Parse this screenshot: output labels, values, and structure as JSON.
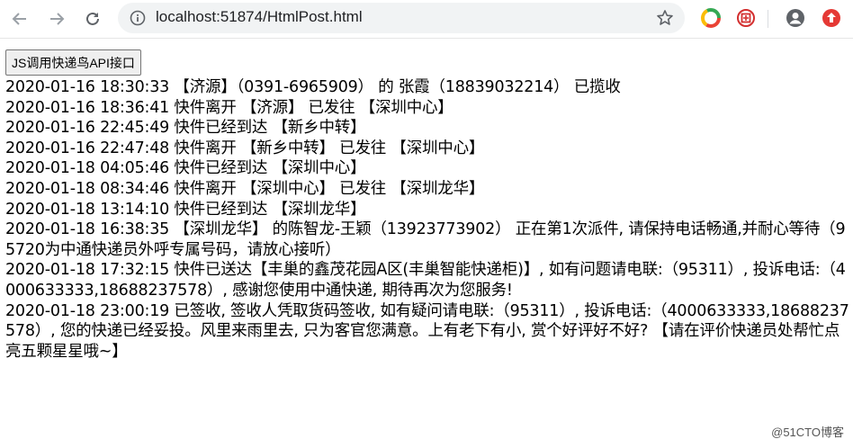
{
  "browser": {
    "url": "localhost:51874/HtmlPost.html",
    "icons": {
      "back": "back-arrow-icon",
      "forward": "forward-arrow-icon",
      "reload": "reload-icon",
      "info": "site-info-icon",
      "bookmark": "bookmark-star-icon",
      "extension1": "chrome-color-circle-icon",
      "extension2": "red-seal-icon",
      "profile": "profile-avatar-icon",
      "update": "red-update-arrow-icon"
    }
  },
  "page": {
    "button_label": "JS调用快递鸟API接口",
    "log_lines": [
      "2020-01-16 18:30:33 【济源】（0391-6965909） 的 张霞（18839032214） 已揽收",
      "2020-01-16 18:36:41 快件离开 【济源】 已发往 【深圳中心】",
      "2020-01-16 22:45:49 快件已经到达 【新乡中转】",
      "2020-01-16 22:47:48 快件离开 【新乡中转】 已发往 【深圳中心】",
      "2020-01-18 04:05:46 快件已经到达 【深圳中心】",
      "2020-01-18 08:34:46 快件离开 【深圳中心】 已发往 【深圳龙华】",
      "2020-01-18 13:14:10 快件已经到达 【深圳龙华】",
      "2020-01-18 16:38:35 【深圳龙华】 的陈智龙-王颖（13923773902） 正在第1次派件, 请保持电话畅通,并耐心等待（95720为中通快递员外呼专属号码，请放心接听）",
      "2020-01-18 17:32:15 快件已送达【丰巢的鑫茂花园A区(丰巢智能快递柜)】, 如有问题请电联:（95311）, 投诉电话:（4000633333,18688237578）, 感谢您使用中通快递, 期待再次为您服务!",
      "2020-01-18 23:00:19 已签收, 签收人凭取货码签收, 如有疑问请电联:（95311）, 投诉电话:（4000633333,18688237578）, 您的快递已经妥投。风里来雨里去, 只为客官您满意。上有老下有小, 赏个好评好不好? 【请在评价快递员处帮忙点亮五颗星星哦~】"
    ]
  },
  "watermark": "@51CTO博客",
  "colors": {
    "toolbar_icon": "#5f6368",
    "omnibox_bg": "#f1f3f4",
    "update_red": "#e53935"
  }
}
